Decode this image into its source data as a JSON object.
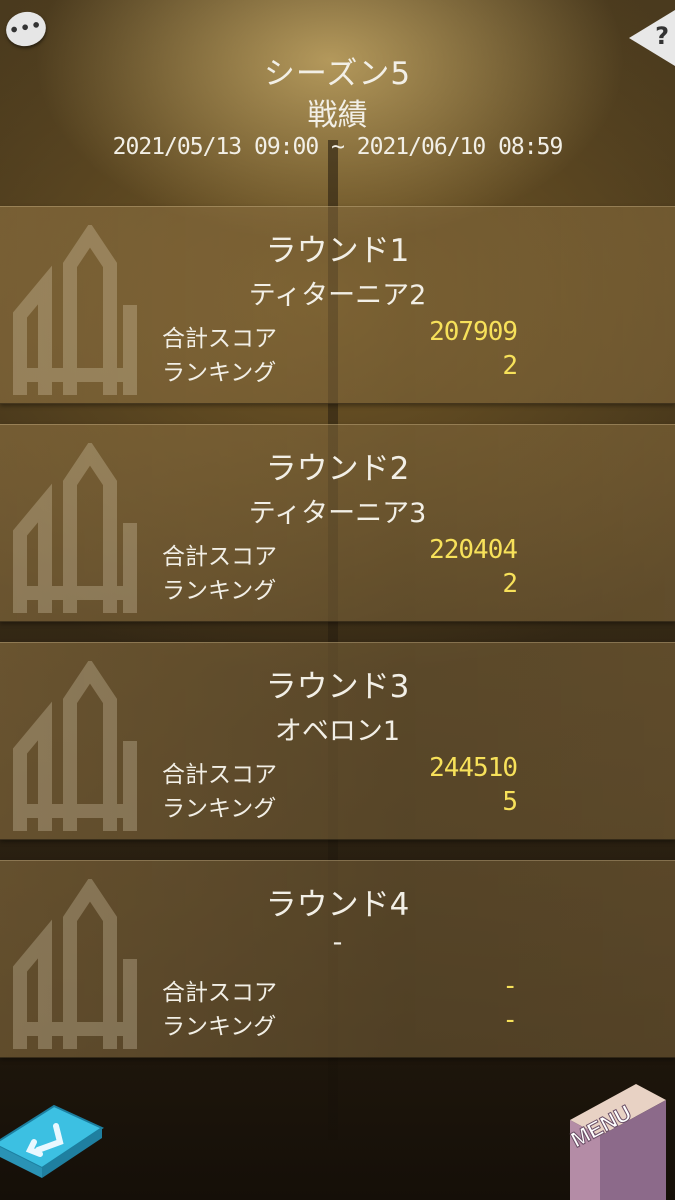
{
  "header": {
    "season": "シーズン5",
    "title": "戦績",
    "period": "2021/05/13 09:00 ~ 2021/06/10 08:59"
  },
  "labels": {
    "total_score": "合計スコア",
    "ranking": "ランキング"
  },
  "rounds": [
    {
      "title": "ラウンド1",
      "stage": "ティターニア2",
      "score": "207909",
      "rank": "2"
    },
    {
      "title": "ラウンド2",
      "stage": "ティターニア3",
      "score": "220404",
      "rank": "2"
    },
    {
      "title": "ラウンド3",
      "stage": "オベロン1",
      "score": "244510",
      "rank": "5"
    },
    {
      "title": "ラウンド4",
      "stage": "-",
      "score": "-",
      "rank": "-"
    }
  ],
  "buttons": {
    "help": "?",
    "chat": "•••",
    "menu": "MENU"
  },
  "icons": {
    "chat": "chat-bubble-icon",
    "help": "help-icon",
    "back": "back-arrow-icon",
    "emblem": "tower-emblem-icon"
  },
  "colors": {
    "value_yellow": "#f7e15a",
    "back_button": "#38b6d8",
    "menu_button": "#c9a9c9"
  }
}
